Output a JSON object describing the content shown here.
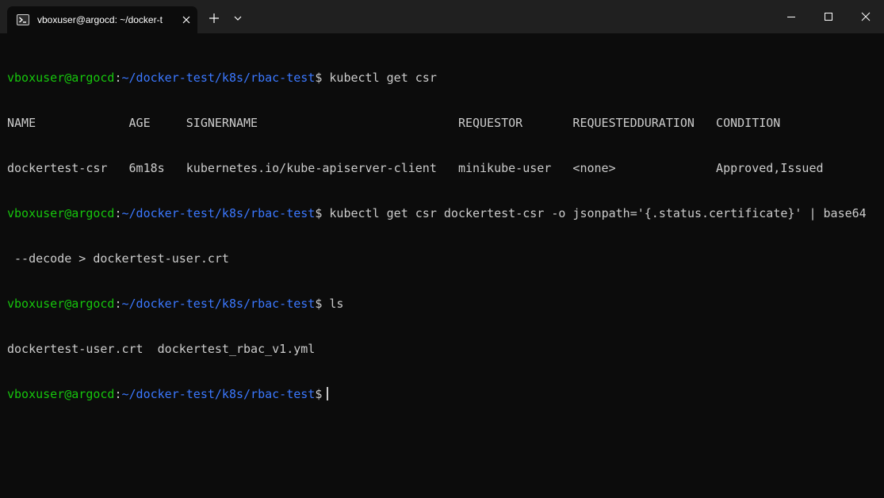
{
  "tab": {
    "title": "vboxuser@argocd: ~/docker-t",
    "icon": "powershell-icon"
  },
  "prompt": {
    "user_host": "vboxuser@argocd",
    "colon": ":",
    "path": "~/docker-test/k8s/rbac-test",
    "symbol": "$"
  },
  "lines": [
    {
      "kind": "prompt",
      "command": " kubectl get csr"
    },
    {
      "kind": "output",
      "text": "NAME             AGE     SIGNERNAME                            REQUESTOR       REQUESTEDDURATION   CONDITION"
    },
    {
      "kind": "output",
      "text": "dockertest-csr   6m18s   kubernetes.io/kube-apiserver-client   minikube-user   <none>              Approved,Issued"
    },
    {
      "kind": "prompt",
      "command": " kubectl get csr dockertest-csr -o jsonpath='{.status.certificate}' | base64"
    },
    {
      "kind": "output",
      "text": " --decode > dockertest-user.crt"
    },
    {
      "kind": "prompt",
      "command": " ls"
    },
    {
      "kind": "output",
      "text": "dockertest-user.crt  dockertest_rbac_v1.yml"
    },
    {
      "kind": "prompt",
      "command": " "
    }
  ],
  "colors": {
    "user_host": "#16c60c",
    "path": "#3b78ff",
    "text": "#cccccc",
    "background": "#0c0c0c",
    "titlebar": "#202020"
  }
}
